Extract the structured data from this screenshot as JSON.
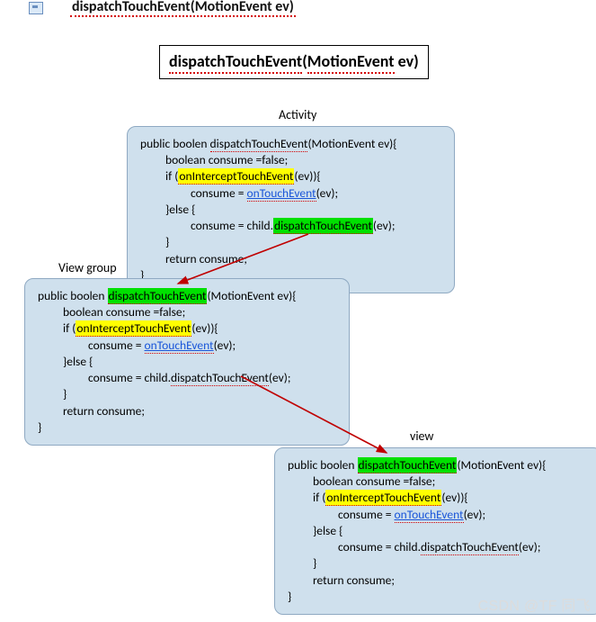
{
  "header": {
    "icon": "slide-icon",
    "text": "dispatchTouchEvent(MotionEvent ev)"
  },
  "title": {
    "word1": "dispatchTouchEvent",
    "word2_open": "(",
    "word2": "MotionEvent",
    "word3": " ev)"
  },
  "labels": {
    "activity": "Activity",
    "viewgroup": "View group",
    "view": "view"
  },
  "code": {
    "sig_pre": "public boolen ",
    "sig_name": "dispatchTouchEvent",
    "sig_post": "(MotionEvent ev){",
    "l2": "boolean consume =false;",
    "if_pre": "if (",
    "if_name": "onInterceptTouchEvent",
    "if_post": "(ev)){",
    "cons_eq": "consume = ",
    "onTouch": "onTouchEvent",
    "onTouch_post": "(ev);",
    "else": "}else {",
    "child_pre": "consume = child.",
    "child_call": "dispatchTouchEvent",
    "child_post": "(ev);",
    "brace": "}",
    "ret": "return consume;"
  },
  "watermark": "CSDN @TF 同飞"
}
